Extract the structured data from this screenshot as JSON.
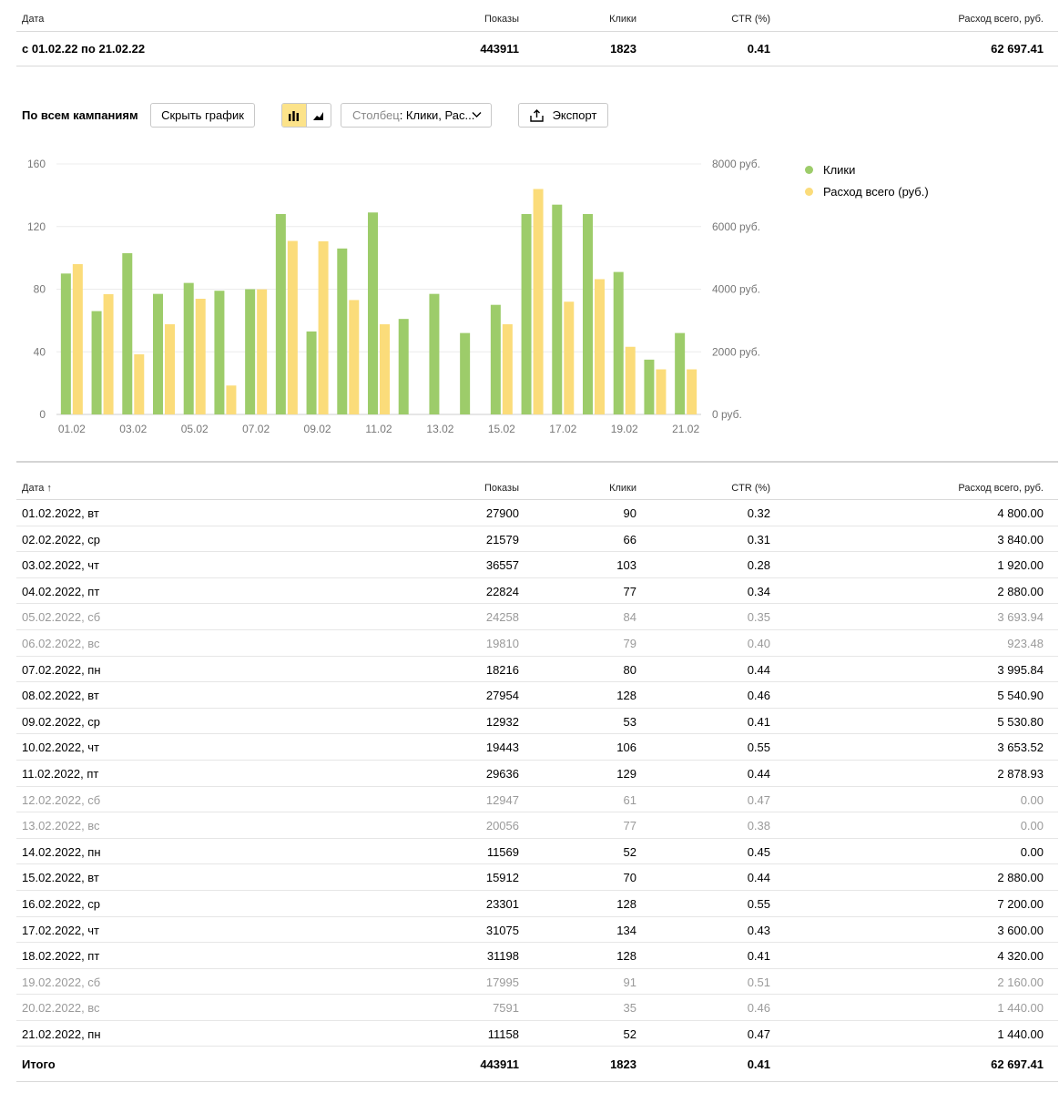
{
  "columns": {
    "date": "Дата",
    "date_sorted": "Дата ↑",
    "shows": "Показы",
    "clicks": "Клики",
    "ctr": "CTR (%)",
    "spend": "Расход всего, руб."
  },
  "summary": {
    "date": "с 01.02.22 по 21.02.22",
    "shows": "443911",
    "clicks": "1823",
    "ctr": "0.41",
    "spend": "62 697.41"
  },
  "toolbar": {
    "title": "По всем кампаниям",
    "hide_chart": "Скрыть график",
    "column_prefix": "Столбец",
    "column_value": ": Клики, Рас...",
    "export": "Экспорт"
  },
  "colors": {
    "clicks": "#9dcc6a",
    "spend": "#fbdc7a",
    "active_toggle": "#fce38a",
    "weekend_text": "#9a9a9a"
  },
  "chart_data": {
    "type": "bar",
    "categories": [
      "01.02",
      "02.02",
      "03.02",
      "04.02",
      "05.02",
      "06.02",
      "07.02",
      "08.02",
      "09.02",
      "10.02",
      "11.02",
      "12.02",
      "13.02",
      "14.02",
      "15.02",
      "16.02",
      "17.02",
      "18.02",
      "19.02",
      "20.02",
      "21.02"
    ],
    "x_tick_labels": [
      "01.02",
      "03.02",
      "05.02",
      "07.02",
      "09.02",
      "11.02",
      "13.02",
      "15.02",
      "17.02",
      "19.02",
      "21.02"
    ],
    "series": [
      {
        "name": "Клики",
        "axis": "left",
        "color": "#9dcc6a",
        "values": [
          90,
          66,
          103,
          77,
          84,
          79,
          80,
          128,
          53,
          106,
          129,
          61,
          77,
          52,
          70,
          128,
          134,
          128,
          91,
          35,
          52
        ]
      },
      {
        "name": "Расход всего (руб.)",
        "axis": "right",
        "color": "#fbdc7a",
        "values": [
          4800.0,
          3840.0,
          1920.0,
          2880.0,
          3693.94,
          923.48,
          3995.84,
          5540.9,
          5530.8,
          3653.52,
          2878.93,
          0.0,
          0.0,
          0.0,
          2880.0,
          7200.0,
          3600.0,
          4320.0,
          2160.0,
          1440.0,
          1440.0
        ]
      }
    ],
    "y_left": {
      "ylim": [
        0,
        160
      ],
      "ticks": [
        "0",
        "40",
        "80",
        "120",
        "160"
      ]
    },
    "y_right": {
      "ylim": [
        0,
        8000
      ],
      "ticks": [
        "0 руб.",
        "2000 руб.",
        "4000 руб.",
        "6000 руб.",
        "8000 руб."
      ]
    },
    "grid": true,
    "legend_position": "right"
  },
  "rows": [
    {
      "date": "01.02.2022, вт",
      "shows": "27900",
      "clicks": "90",
      "ctr": "0.32",
      "spend": "4 800.00",
      "weekend": false
    },
    {
      "date": "02.02.2022, ср",
      "shows": "21579",
      "clicks": "66",
      "ctr": "0.31",
      "spend": "3 840.00",
      "weekend": false
    },
    {
      "date": "03.02.2022, чт",
      "shows": "36557",
      "clicks": "103",
      "ctr": "0.28",
      "spend": "1 920.00",
      "weekend": false
    },
    {
      "date": "04.02.2022, пт",
      "shows": "22824",
      "clicks": "77",
      "ctr": "0.34",
      "spend": "2 880.00",
      "weekend": false
    },
    {
      "date": "05.02.2022, сб",
      "shows": "24258",
      "clicks": "84",
      "ctr": "0.35",
      "spend": "3 693.94",
      "weekend": true
    },
    {
      "date": "06.02.2022, вс",
      "shows": "19810",
      "clicks": "79",
      "ctr": "0.40",
      "spend": "923.48",
      "weekend": true
    },
    {
      "date": "07.02.2022, пн",
      "shows": "18216",
      "clicks": "80",
      "ctr": "0.44",
      "spend": "3 995.84",
      "weekend": false
    },
    {
      "date": "08.02.2022, вт",
      "shows": "27954",
      "clicks": "128",
      "ctr": "0.46",
      "spend": "5 540.90",
      "weekend": false
    },
    {
      "date": "09.02.2022, ср",
      "shows": "12932",
      "clicks": "53",
      "ctr": "0.41",
      "spend": "5 530.80",
      "weekend": false
    },
    {
      "date": "10.02.2022, чт",
      "shows": "19443",
      "clicks": "106",
      "ctr": "0.55",
      "spend": "3 653.52",
      "weekend": false
    },
    {
      "date": "11.02.2022, пт",
      "shows": "29636",
      "clicks": "129",
      "ctr": "0.44",
      "spend": "2 878.93",
      "weekend": false
    },
    {
      "date": "12.02.2022, сб",
      "shows": "12947",
      "clicks": "61",
      "ctr": "0.47",
      "spend": "0.00",
      "weekend": true
    },
    {
      "date": "13.02.2022, вс",
      "shows": "20056",
      "clicks": "77",
      "ctr": "0.38",
      "spend": "0.00",
      "weekend": true
    },
    {
      "date": "14.02.2022, пн",
      "shows": "11569",
      "clicks": "52",
      "ctr": "0.45",
      "spend": "0.00",
      "weekend": false
    },
    {
      "date": "15.02.2022, вт",
      "shows": "15912",
      "clicks": "70",
      "ctr": "0.44",
      "spend": "2 880.00",
      "weekend": false
    },
    {
      "date": "16.02.2022, ср",
      "shows": "23301",
      "clicks": "128",
      "ctr": "0.55",
      "spend": "7 200.00",
      "weekend": false
    },
    {
      "date": "17.02.2022, чт",
      "shows": "31075",
      "clicks": "134",
      "ctr": "0.43",
      "spend": "3 600.00",
      "weekend": false
    },
    {
      "date": "18.02.2022, пт",
      "shows": "31198",
      "clicks": "128",
      "ctr": "0.41",
      "spend": "4 320.00",
      "weekend": false
    },
    {
      "date": "19.02.2022, сб",
      "shows": "17995",
      "clicks": "91",
      "ctr": "0.51",
      "spend": "2 160.00",
      "weekend": true
    },
    {
      "date": "20.02.2022, вс",
      "shows": "7591",
      "clicks": "35",
      "ctr": "0.46",
      "spend": "1 440.00",
      "weekend": true
    },
    {
      "date": "21.02.2022, пн",
      "shows": "11158",
      "clicks": "52",
      "ctr": "0.47",
      "spend": "1 440.00",
      "weekend": false
    }
  ],
  "total": {
    "label": "Итого",
    "shows": "443911",
    "clicks": "1823",
    "ctr": "0.41",
    "spend": "62 697.41"
  }
}
